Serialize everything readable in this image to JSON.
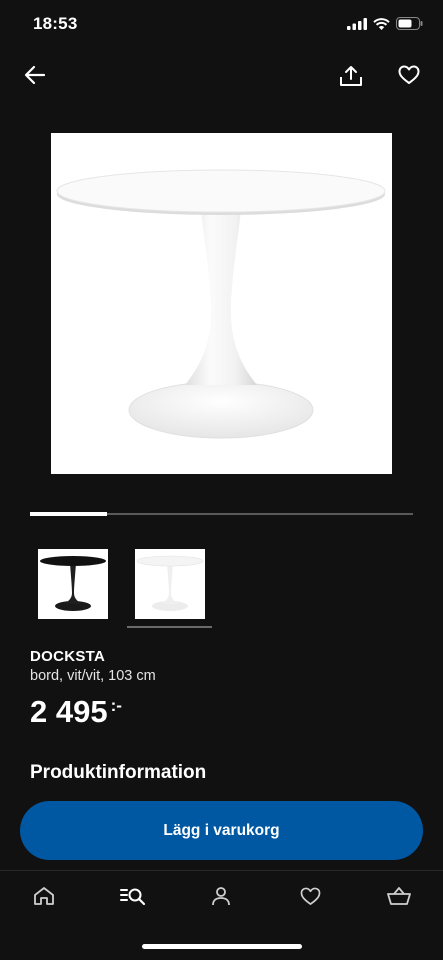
{
  "status_bar": {
    "time": "18:53"
  },
  "header": {
    "back_icon": "arrow-left-icon",
    "share_icon": "share-icon",
    "favorite_icon": "heart-icon"
  },
  "gallery": {
    "image_count": 2,
    "active_index": 1,
    "progress_fraction": 0.2
  },
  "thumbnails": [
    {
      "icon": "black-table-icon",
      "variant": "black"
    },
    {
      "icon": "white-table-icon",
      "variant": "white",
      "selected": true
    }
  ],
  "product": {
    "name": "DOCKSTA",
    "description": "bord, vit/vit, 103 cm",
    "price": "2 495",
    "price_suffix": ":-"
  },
  "section": {
    "title": "Produktinformation"
  },
  "cart_button": {
    "label": "Lägg i varukorg"
  },
  "colors": {
    "background": "#111111",
    "accent": "#0058a3"
  },
  "tabbar": [
    {
      "name": "tab-home",
      "icon": "home-icon"
    },
    {
      "name": "tab-search",
      "icon": "search-list-icon"
    },
    {
      "name": "tab-profile",
      "icon": "person-icon"
    },
    {
      "name": "tab-favorites",
      "icon": "heart-icon"
    },
    {
      "name": "tab-cart",
      "icon": "basket-icon"
    }
  ]
}
